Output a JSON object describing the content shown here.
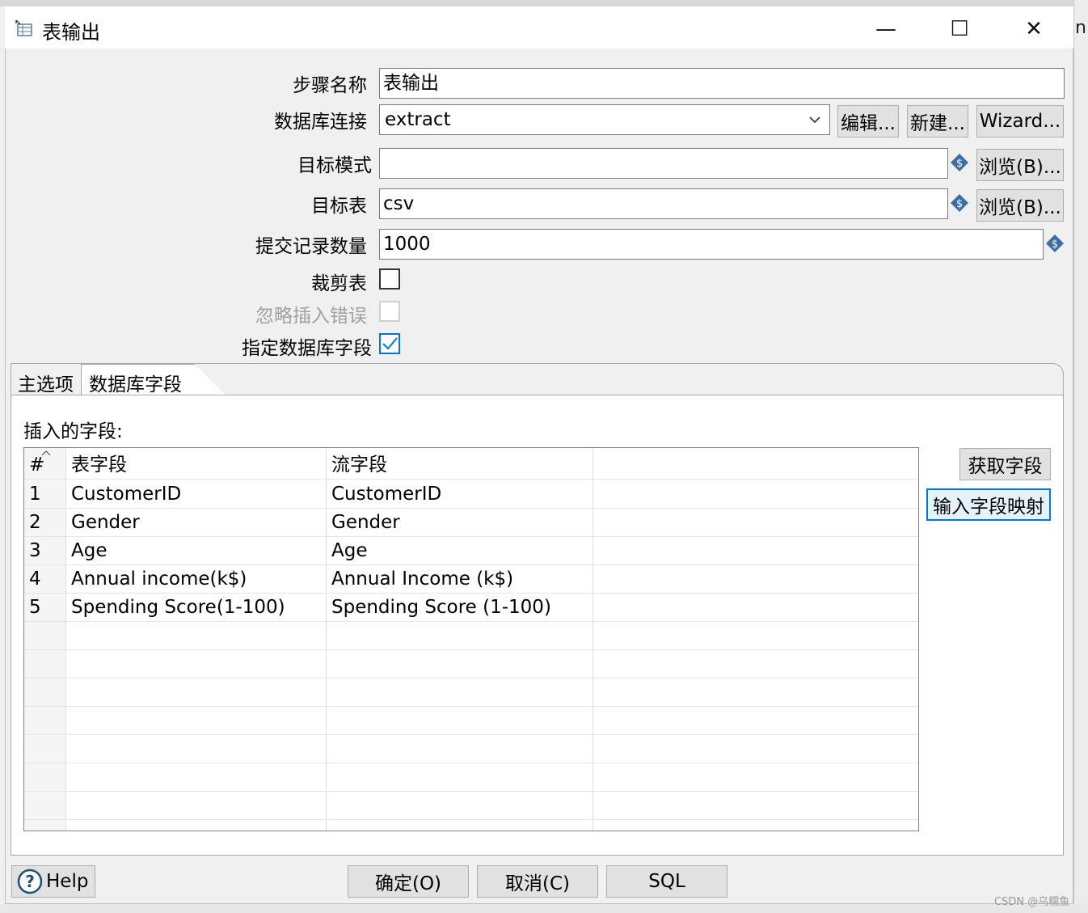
{
  "window": {
    "title": "表输出",
    "controls": {
      "minimize": "—",
      "maximize": "☐",
      "close": "✕"
    }
  },
  "background": {
    "right_text": "nis"
  },
  "form": {
    "step_name_label": "步骤名称",
    "step_name_value": "表输出",
    "db_conn_label": "数据库连接",
    "db_conn_value": "extract",
    "edit_label": "编辑...",
    "new_label": "新建...",
    "wizard_label": "Wizard...",
    "target_schema_label": "目标模式",
    "target_schema_value": "",
    "browse_label": "浏览(B)...",
    "target_table_label": "目标表",
    "target_table_value": "csv",
    "commit_size_label": "提交记录数量",
    "commit_size_value": "1000",
    "truncate_label": "裁剪表",
    "truncate_checked": false,
    "ignore_errors_label": "忽略插入错误",
    "ignore_errors_checked": false,
    "specify_fields_label": "指定数据库字段",
    "specify_fields_checked": true
  },
  "tabs": [
    {
      "label": "主选项",
      "active": false
    },
    {
      "label": "数据库字段",
      "active": true
    }
  ],
  "fields_panel": {
    "title": "插入的字段:",
    "columns": [
      "#",
      "表字段",
      "流字段"
    ],
    "rows": [
      {
        "n": "1",
        "table_field": "CustomerID",
        "stream_field": "CustomerID"
      },
      {
        "n": "2",
        "table_field": "Gender",
        "stream_field": "Gender"
      },
      {
        "n": "3",
        "table_field": "Age",
        "stream_field": "Age"
      },
      {
        "n": "4",
        "table_field": "Annual income(k$)",
        "stream_field": "Annual Income (k$)"
      },
      {
        "n": "5",
        "table_field": "Spending Score(1-100)",
        "stream_field": "Spending Score (1-100)"
      }
    ],
    "get_fields_label": "获取字段",
    "map_fields_label": "输入字段映射"
  },
  "footer": {
    "help_label": "Help",
    "ok_label": "确定(O)",
    "cancel_label": "取消(C)",
    "sql_label": "SQL"
  },
  "watermark": "CSDN @乌糯鱼",
  "colors": {
    "accent": "#0078d7",
    "var_icon": "#3a6ea5",
    "button_bg": "#e1e1e1"
  }
}
